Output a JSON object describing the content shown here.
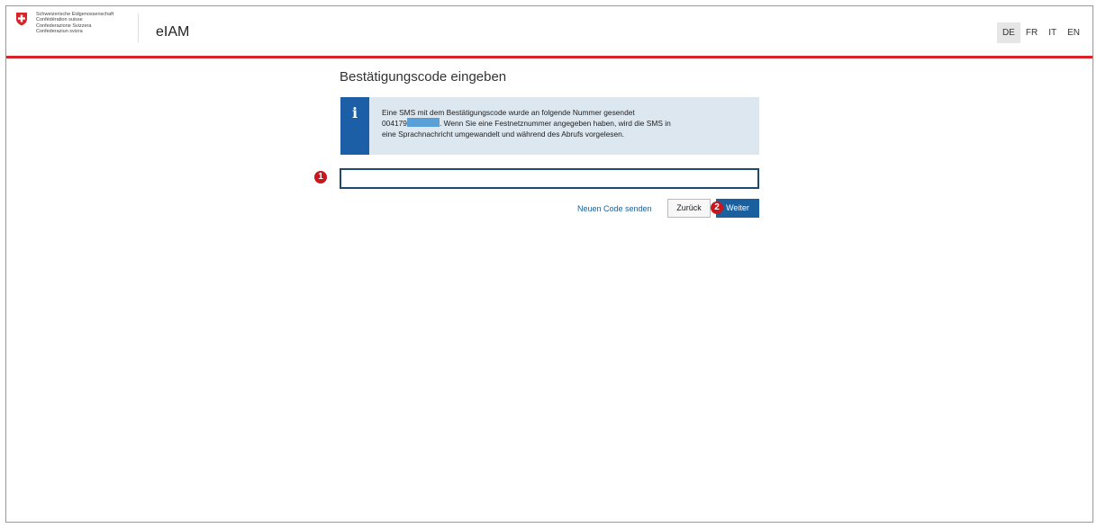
{
  "header": {
    "confederation_lines": [
      "Schweizerische Eidgenossenschaft",
      "Confédération suisse",
      "Confederazione Svizzera",
      "Confederaziun svizra"
    ],
    "app_title": "eIAM",
    "languages": [
      {
        "code": "DE",
        "active": true
      },
      {
        "code": "FR",
        "active": false
      },
      {
        "code": "IT",
        "active": false
      },
      {
        "code": "EN",
        "active": false
      }
    ]
  },
  "main": {
    "title": "Bestätigungscode eingeben",
    "info": {
      "icon": "info-icon",
      "line1": "Eine SMS mit dem Bestätigungscode wurde an folgende Nummer gesendet",
      "phone_prefix": "004179",
      "line2_rest": ". Wenn Sie eine Festnetznummer angegeben haben, wird die SMS in",
      "line3": "eine Sprachnachricht umgewandelt und während des Abrufs vorgelesen."
    },
    "code_input": {
      "value": "",
      "placeholder": ""
    },
    "resend_label": "Neuen Code senden",
    "back_label": "Zurück",
    "next_label": "Weiter"
  },
  "annotations": {
    "badge1": "1",
    "badge2": "2"
  },
  "colors": {
    "swiss_red": "#d8232a",
    "primary_blue": "#1a5f9e",
    "info_bg": "#dde7ef"
  }
}
